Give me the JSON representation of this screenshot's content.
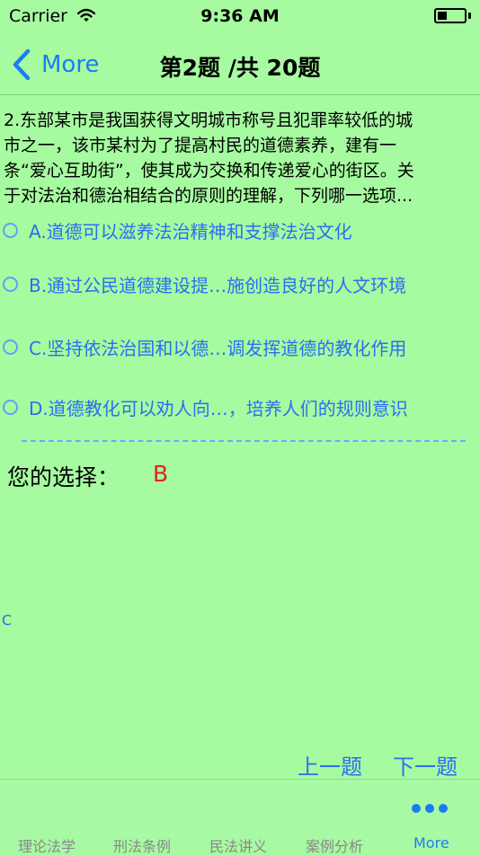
{
  "status": {
    "carrier": "Carrier",
    "time": "9:36 AM"
  },
  "nav": {
    "back_label": "More",
    "title": "第2题 /共 20题"
  },
  "question": {
    "lines": [
      "2.东部某市是我国获得文明城市称号且犯罪率较低的城",
      "市之一，该市某村为了提高村民的道德素养，建有一",
      "条“爱心互助街”，使其成为交换和传递爱心的街区。关",
      "于对法治和德治相结合的原则的理解，下列哪一选项..."
    ]
  },
  "options": [
    {
      "label": "A.道德可以滋养法治精神和支撑法治文化"
    },
    {
      "label": "B.通过公民道德建设提…施创造良好的人文环境"
    },
    {
      "label": "C.坚持依法治国和以德…调发挥道德的教化作用"
    },
    {
      "label": "D.道德教化可以劝人向…，培养人们的规则意识"
    }
  ],
  "choice": {
    "label": "您的选择：",
    "value": "B"
  },
  "answer": "C",
  "buttons": {
    "prev": "上一题",
    "next": "下一题"
  },
  "tabs": [
    {
      "label": "理论法学"
    },
    {
      "label": "刑法条例"
    },
    {
      "label": "民法讲义"
    },
    {
      "label": "案例分析"
    },
    {
      "label": "More"
    }
  ],
  "colors": {
    "background": "#a6fba0",
    "accent": "#1b7cf2",
    "selection": "#e2231a"
  }
}
